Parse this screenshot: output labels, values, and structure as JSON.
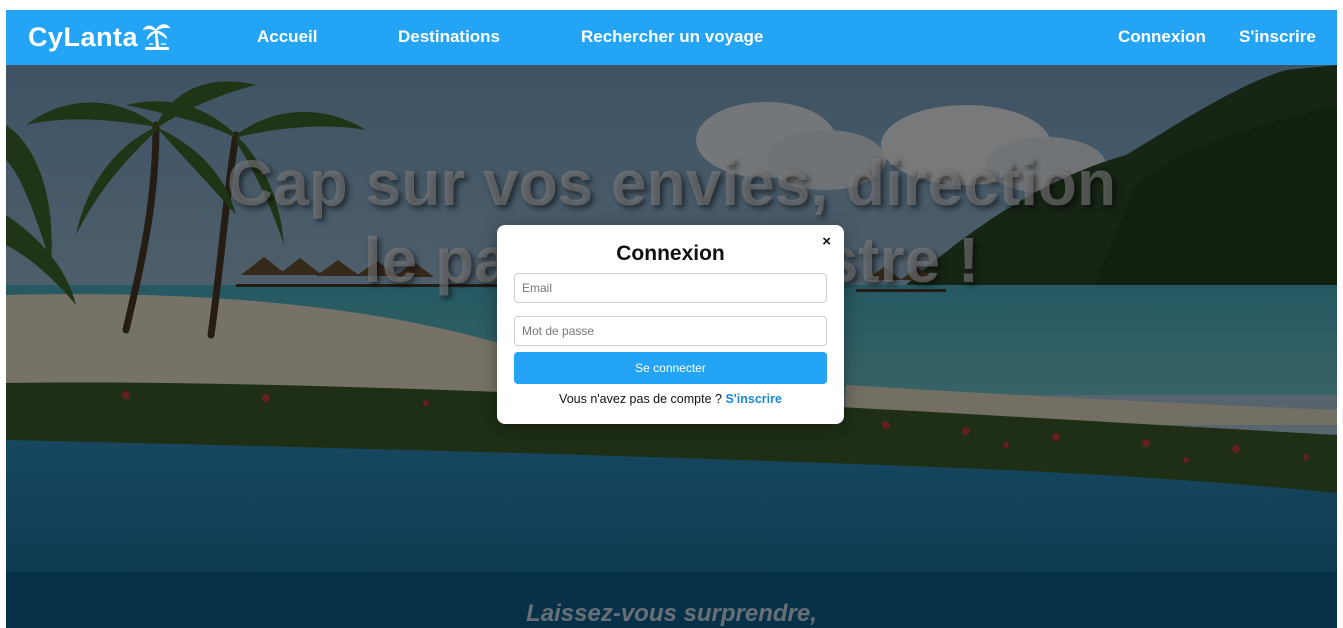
{
  "brand": {
    "name": "CyLanta",
    "logo_icon": "palm-tree-icon",
    "accent": "#23a4f4"
  },
  "nav": {
    "home": "Accueil",
    "destinations": "Destinations",
    "search": "Rechercher un voyage",
    "login": "Connexion",
    "signup": "S'inscrire"
  },
  "hero": {
    "title_line1": "Cap sur vos envies, direction",
    "title_line2": "le paradis terrestre !"
  },
  "band": {
    "text": "Laissez-vous surprendre,"
  },
  "modal": {
    "title": "Connexion",
    "close": "×",
    "email_placeholder": "Email",
    "password_placeholder": "Mot de passe",
    "submit": "Se connecter",
    "signup_prompt": "Vous n'avez pas de compte ?",
    "signup_link": "S'inscrire"
  }
}
